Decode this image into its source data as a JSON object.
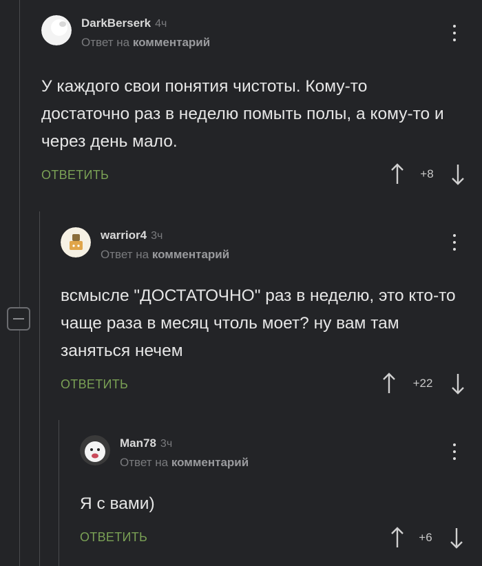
{
  "comments": [
    {
      "author": "DarkBerserk",
      "time": "4ч",
      "reply_prefix": "Ответ на",
      "reply_target": "комментарий",
      "text": "У каждого свои понятия чистоты. Кому-то достаточно раз в неделю помыть полы, а кому-то и через день мало.",
      "reply_label": "ОТВЕТИТЬ",
      "score": "+8"
    },
    {
      "author": "warrior4",
      "time": "3ч",
      "reply_prefix": "Ответ на",
      "reply_target": "комментарий",
      "text": "всмысле \"ДОСТАТОЧНО\" раз в неделю, это кто-то чаще раза в месяц чтоль моет? ну вам там заняться нечем",
      "reply_label": "ОТВЕТИТЬ",
      "score": "+22"
    },
    {
      "author": "Man78",
      "time": "3ч",
      "reply_prefix": "Ответ на",
      "reply_target": "комментарий",
      "text": "Я с вами)",
      "reply_label": "ОТВЕТИТЬ",
      "score": "+6"
    }
  ],
  "colors": {
    "background": "#232427",
    "reply_action": "#7aa155",
    "muted": "#7a7b7e",
    "thread_line": "#4a4b4e"
  },
  "icons": [
    "kebab-menu-icon",
    "upvote-arrow-icon",
    "downvote-arrow-icon",
    "collapse-minus-icon"
  ]
}
